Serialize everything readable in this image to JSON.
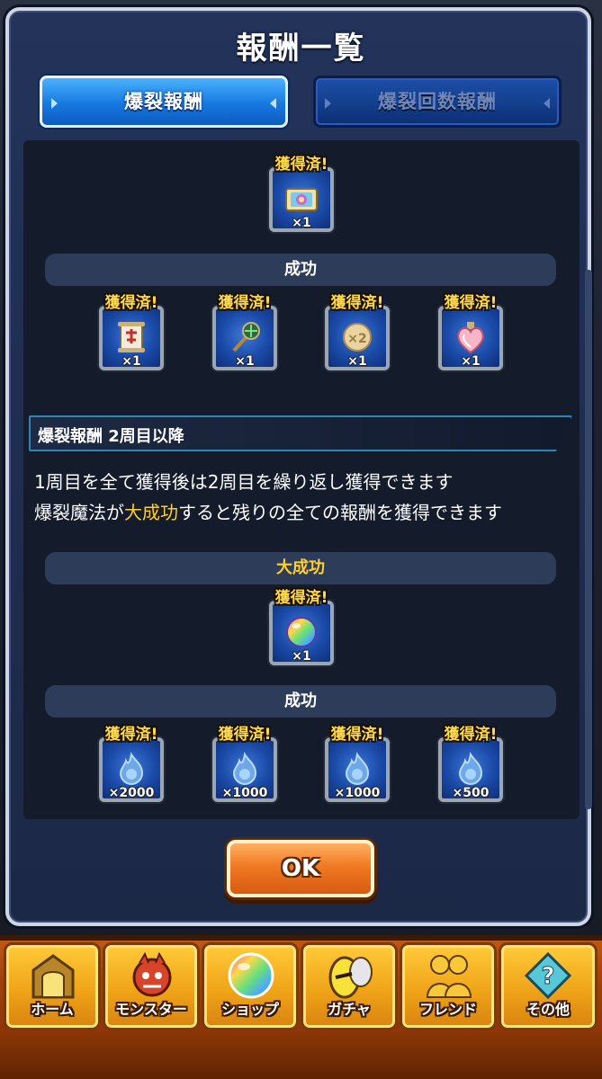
{
  "dialog": {
    "title": "報酬一覧",
    "tabs": [
      {
        "label": "爆裂報酬",
        "active": true
      },
      {
        "label": "爆裂回数報酬",
        "active": false
      }
    ]
  },
  "first_lap": {
    "top_reward": {
      "badge": "獲得済!",
      "qty": "×1",
      "icon": "ticket-icon"
    },
    "success_section": {
      "label": "成功",
      "rewards": [
        {
          "badge": "獲得済!",
          "qty": "×1",
          "icon": "scroll-icon"
        },
        {
          "badge": "獲得済!",
          "qty": "×1",
          "icon": "magic-wand-icon"
        },
        {
          "badge": "獲得済!",
          "qty": "×1",
          "icon": "x2-cookie-icon"
        },
        {
          "badge": "獲得済!",
          "qty": "×1",
          "icon": "heart-potion-icon"
        }
      ]
    }
  },
  "second_lap": {
    "header": "爆裂報酬 2周目以降",
    "description_line1": "1周目を全て獲得後は2周目を繰り返し獲得できます",
    "description_line2_pre": "爆裂魔法が",
    "description_line2_highlight": "大成功",
    "description_line2_post": "すると残りの全ての報酬を獲得できます",
    "great_success_section": {
      "label": "大成功",
      "reward": {
        "badge": "獲得済!",
        "qty": "×1",
        "icon": "rainbow-orb-icon"
      }
    },
    "success_section": {
      "label": "成功",
      "rewards": [
        {
          "badge": "獲得済!",
          "qty": "×2000",
          "icon": "flame-orb-icon"
        },
        {
          "badge": "獲得済!",
          "qty": "×1000",
          "icon": "flame-orb-icon"
        },
        {
          "badge": "獲得済!",
          "qty": "×1000",
          "icon": "flame-orb-icon"
        },
        {
          "badge": "獲得済!",
          "qty": "×500",
          "icon": "flame-orb-icon"
        }
      ]
    }
  },
  "ok_button": {
    "label": "OK"
  },
  "bottom_nav": {
    "items": [
      {
        "label": "ホーム",
        "icon": "gate-icon"
      },
      {
        "label": "モンスター",
        "icon": "dragon-icon"
      },
      {
        "label": "ショップ",
        "icon": "rainbow-orb-icon"
      },
      {
        "label": "ガチャ",
        "icon": "eggs-icon"
      },
      {
        "label": "フレンド",
        "icon": "friends-icon"
      },
      {
        "label": "その他",
        "icon": "question-icon"
      }
    ]
  },
  "colors": {
    "highlight": "#ffcf2e",
    "badge": "#ffd94a",
    "section_label_success": "#ffffff",
    "section_label_great": "#ffcf2e"
  }
}
